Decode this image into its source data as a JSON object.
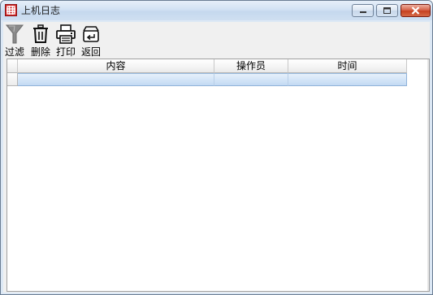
{
  "window": {
    "title": "上机日志",
    "controls": [
      "minimize",
      "maximize",
      "close"
    ]
  },
  "toolbar": {
    "items": [
      {
        "label": "过滤",
        "icon": "filter-icon"
      },
      {
        "label": "删除",
        "icon": "trash-icon"
      },
      {
        "label": "打印",
        "icon": "printer-icon"
      },
      {
        "label": "返回",
        "icon": "return-icon"
      }
    ]
  },
  "grid": {
    "columns": [
      "内容",
      "操作员",
      "时间"
    ],
    "rows": [
      {
        "content": "",
        "operator": "",
        "time": "",
        "selected": true
      }
    ]
  },
  "colors": {
    "title_bar": "#cfdff1",
    "close_button": "#c6401f",
    "selected_row": "#d2e4f7",
    "app_icon": "#d42a2a"
  }
}
